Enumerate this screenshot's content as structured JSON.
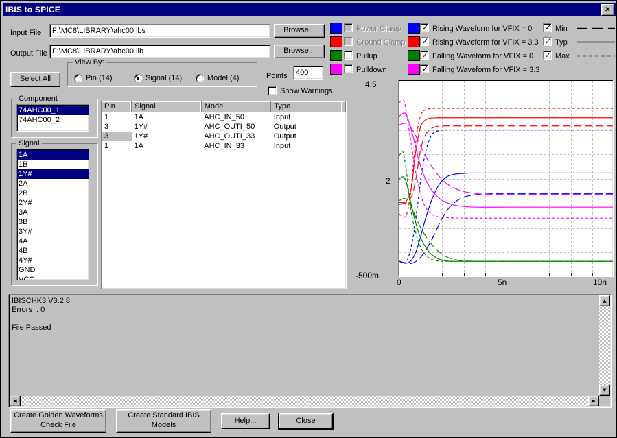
{
  "window": {
    "title": "IBIS to SPICE",
    "close_label": "✕"
  },
  "form": {
    "input_file_label": "Input File",
    "input_file_value": "F:\\MC8\\LIBRARY\\ahc00.ibs",
    "output_file_label": "Output File",
    "output_file_value": "F:\\MC8\\LIBRARY\\ahc00.lib",
    "browse_input_label": "Browse...",
    "browse_output_label": "Browse...",
    "select_all_label": "Select All",
    "points_label": "Points",
    "points_value": "400",
    "show_warnings_label": "Show Warnings",
    "show_warnings_checked": false
  },
  "view_by": {
    "title": "View By:",
    "options": [
      {
        "label": "Pin (14)",
        "selected": false
      },
      {
        "label": "Signal (14)",
        "selected": true
      },
      {
        "label": "Model (4)",
        "selected": false
      }
    ]
  },
  "component": {
    "title": "Component",
    "items": [
      {
        "label": "74AHC00_1",
        "selected": true
      },
      {
        "label": "74AHC00_2",
        "selected": false
      }
    ]
  },
  "signal": {
    "title": "Signal",
    "items": [
      {
        "label": "1A",
        "selected": true
      },
      {
        "label": "1B",
        "selected": false
      },
      {
        "label": "1Y#",
        "selected": true
      },
      {
        "label": "2A",
        "selected": false
      },
      {
        "label": "2B",
        "selected": false
      },
      {
        "label": "2Y#",
        "selected": false
      },
      {
        "label": "3A",
        "selected": false
      },
      {
        "label": "3B",
        "selected": false
      },
      {
        "label": "3Y#",
        "selected": false
      },
      {
        "label": "4A",
        "selected": false
      },
      {
        "label": "4B",
        "selected": false
      },
      {
        "label": "4Y#",
        "selected": false
      },
      {
        "label": "GND",
        "selected": false
      },
      {
        "label": "VCC",
        "selected": false
      }
    ]
  },
  "grid": {
    "columns": [
      "Pin",
      "Signal",
      "Model",
      "Type"
    ],
    "rows": [
      {
        "pin": "1",
        "signal": "1A",
        "model": "AHC_IN_50",
        "type": "Input",
        "selected": false
      },
      {
        "pin": "3",
        "signal": "1Y#",
        "model": "AHC_OUTI_50",
        "type": "Output",
        "selected": false
      },
      {
        "pin": "3",
        "signal": "1Y#",
        "model": "AHC_OUTI_33",
        "type": "Output",
        "selected": true
      },
      {
        "pin": "1",
        "signal": "1A",
        "model": "AHC_IN_33",
        "type": "Input",
        "selected": false
      }
    ]
  },
  "legend": {
    "curve_types": [
      {
        "label": "Power Clamp",
        "color": "#0000ff",
        "checked": false,
        "disabled": true
      },
      {
        "label": "Ground Clamp",
        "color": "#ff0000",
        "checked": false,
        "disabled": true
      },
      {
        "label": "Pullup",
        "color": "#008000",
        "checked": false,
        "disabled": false
      },
      {
        "label": "Pulldown",
        "color": "#ff00ff",
        "checked": false,
        "disabled": false
      }
    ],
    "waveforms": [
      {
        "label": "Rising Waveform for VFIX = 0",
        "color": "#0000ff",
        "checked": true
      },
      {
        "label": "Rising Waveform for VFIX = 3.3",
        "color": "#ff0000",
        "checked": true
      },
      {
        "label": "Falling Waveform for VFIX = 0",
        "color": "#008000",
        "checked": true
      },
      {
        "label": "Falling Waveform for VFIX = 3.3",
        "color": "#ff00ff",
        "checked": true
      }
    ],
    "corners": [
      {
        "label": "Min",
        "checked": true,
        "style": "long-dash"
      },
      {
        "label": "Typ",
        "checked": true,
        "style": "solid"
      },
      {
        "label": "Max",
        "checked": true,
        "style": "short-dash"
      }
    ]
  },
  "log": {
    "text": "IBISCHK3 V3.2.8\nErrors  : 0\n\nFile Passed"
  },
  "buttons": {
    "golden": "Create Golden Waveforms\nCheck File",
    "standard": "Create Standard IBIS\nModels",
    "help": "Help...",
    "close": "Close"
  },
  "chart_data": {
    "type": "line",
    "title": "",
    "xlabel": "",
    "ylabel": "",
    "xlim": [
      0,
      10
    ],
    "ylim": [
      -0.5,
      4.5
    ],
    "xunit": "n",
    "xticks": [
      0,
      5,
      10
    ],
    "xticklabels": [
      "0",
      "5n",
      "10n"
    ],
    "yticks": [
      -0.5,
      2,
      4.5
    ],
    "yticklabels": [
      "-500m",
      "2",
      "4.5"
    ],
    "grid": true,
    "grid_x_count": 10,
    "grid_y_count": 8,
    "legend_position": "top-external",
    "series": [
      {
        "name": "Rising Waveform for VFIX = 3.3 (Max)",
        "color": "#ff0000",
        "style": "short-dash",
        "x": [
          0.0,
          0.3,
          0.5,
          0.65,
          0.8,
          0.95,
          1.1,
          1.3,
          1.6,
          2.0,
          3.0,
          5.0,
          7.5,
          10.0
        ],
        "y": [
          1.1,
          1.05,
          1.55,
          2.35,
          3.1,
          3.55,
          3.72,
          3.78,
          3.8,
          3.8,
          3.8,
          3.8,
          3.8,
          3.8
        ]
      },
      {
        "name": "Rising Waveform for VFIX = 3.3 (Typ)",
        "color": "#ff0000",
        "style": "solid",
        "x": [
          0.0,
          0.3,
          0.55,
          0.7,
          0.85,
          1.0,
          1.2,
          1.45,
          1.8,
          2.2,
          3.0,
          5.0,
          7.5,
          10.0
        ],
        "y": [
          1.4,
          1.42,
          1.75,
          2.45,
          3.0,
          3.35,
          3.5,
          3.55,
          3.56,
          3.56,
          3.56,
          3.56,
          3.56,
          3.56
        ]
      },
      {
        "name": "Rising Waveform for VFIX = 3.3 (Min)",
        "color": "#ff0000",
        "style": "long-dash",
        "x": [
          0.0,
          0.35,
          0.6,
          0.8,
          0.95,
          1.15,
          1.4,
          1.7,
          2.05,
          2.4,
          3.0,
          5.0,
          7.5,
          10.0
        ],
        "y": [
          1.35,
          1.4,
          1.6,
          2.1,
          2.65,
          3.05,
          3.25,
          3.33,
          3.35,
          3.35,
          3.35,
          3.35,
          3.35,
          3.35
        ]
      },
      {
        "name": "Rising Waveform for VFIX = 0 (Max)",
        "color": "#0000ff",
        "style": "short-dash",
        "x": [
          0.0,
          0.25,
          0.45,
          0.65,
          0.85,
          1.05,
          1.3,
          1.55,
          1.85,
          2.2,
          3.0,
          5.0,
          7.5,
          10.0
        ],
        "y": [
          -0.1,
          -0.15,
          0.05,
          0.55,
          1.35,
          2.2,
          2.85,
          3.15,
          3.23,
          3.25,
          3.25,
          3.25,
          3.25,
          3.25
        ]
      },
      {
        "name": "Rising Waveform for VFIX = 0 (Typ)",
        "color": "#0000ff",
        "style": "solid",
        "x": [
          0.0,
          0.4,
          0.7,
          0.95,
          1.2,
          1.5,
          1.85,
          2.2,
          2.6,
          3.0,
          3.4,
          5.0,
          7.5,
          10.0
        ],
        "y": [
          -0.1,
          -0.14,
          0.05,
          0.45,
          0.95,
          1.45,
          1.85,
          2.05,
          2.12,
          2.14,
          2.15,
          2.15,
          2.15,
          2.15
        ]
      },
      {
        "name": "Rising Waveform for VFIX = 0 (Min)",
        "color": "#0000ff",
        "style": "long-dash",
        "x": [
          0.0,
          0.5,
          0.9,
          1.25,
          1.6,
          1.95,
          2.3,
          2.7,
          3.1,
          3.6,
          4.2,
          5.0,
          7.5,
          10.0
        ],
        "y": [
          -0.1,
          -0.16,
          -0.05,
          0.2,
          0.55,
          0.95,
          1.25,
          1.45,
          1.55,
          1.6,
          1.62,
          1.62,
          1.62,
          1.62
        ]
      },
      {
        "name": "Falling Waveform for VFIX = 3.3 (Max)",
        "color": "#ff00ff",
        "style": "short-dash",
        "x": [
          0.0,
          0.2,
          0.35,
          0.55,
          0.75,
          0.95,
          1.15,
          1.4,
          1.7,
          2.1,
          3.0,
          5.0,
          7.5,
          10.0
        ],
        "y": [
          3.95,
          4.0,
          3.6,
          2.9,
          2.2,
          1.7,
          1.35,
          1.15,
          1.05,
          1.02,
          1.0,
          1.0,
          1.0,
          1.0
        ]
      },
      {
        "name": "Falling Waveform for VFIX = 3.3 (Typ)",
        "color": "#ff00ff",
        "style": "solid",
        "x": [
          0.0,
          0.25,
          0.45,
          0.7,
          0.95,
          1.25,
          1.6,
          2.0,
          2.45,
          2.95,
          3.6,
          5.0,
          7.5,
          10.0
        ],
        "y": [
          3.6,
          3.68,
          3.45,
          2.95,
          2.4,
          1.95,
          1.65,
          1.45,
          1.35,
          1.3,
          1.28,
          1.28,
          1.28,
          1.28
        ]
      },
      {
        "name": "Falling Waveform for VFIX = 3.3 (Min)",
        "color": "#ff00ff",
        "style": "long-dash",
        "x": [
          0.0,
          0.3,
          0.55,
          0.85,
          1.2,
          1.6,
          2.05,
          2.5,
          3.0,
          3.5,
          4.1,
          5.0,
          7.5,
          10.0
        ],
        "y": [
          3.38,
          3.42,
          3.3,
          3.0,
          2.6,
          2.25,
          1.95,
          1.78,
          1.68,
          1.63,
          1.61,
          1.6,
          1.6,
          1.6
        ]
      },
      {
        "name": "Falling Waveform for VFIX = 0 (Max)",
        "color": "#008000",
        "style": "short-dash",
        "x": [
          0.0,
          0.15,
          0.3,
          0.45,
          0.6,
          0.8,
          1.0,
          1.2,
          1.45,
          1.75,
          2.1,
          3.0,
          5.0,
          10.0
        ],
        "y": [
          2.6,
          2.7,
          2.3,
          1.6,
          1.0,
          0.55,
          0.25,
          0.08,
          -0.04,
          -0.09,
          -0.1,
          -0.1,
          -0.1,
          -0.1
        ]
      },
      {
        "name": "Falling Waveform for VFIX = 0 (Typ)",
        "color": "#008000",
        "style": "solid",
        "x": [
          0.0,
          0.2,
          0.35,
          0.55,
          0.75,
          0.95,
          1.2,
          1.45,
          1.75,
          2.05,
          2.4,
          3.0,
          5.0,
          10.0
        ],
        "y": [
          2.0,
          2.05,
          1.85,
          1.35,
          0.9,
          0.55,
          0.28,
          0.1,
          -0.02,
          -0.08,
          -0.1,
          -0.1,
          -0.1,
          -0.1
        ]
      },
      {
        "name": "Falling Waveform for VFIX = 0 (Min)",
        "color": "#008000",
        "style": "long-dash",
        "x": [
          0.0,
          0.25,
          0.45,
          0.7,
          0.95,
          1.25,
          1.55,
          1.9,
          2.25,
          2.6,
          3.0,
          3.5,
          5.0,
          10.0
        ],
        "y": [
          1.45,
          1.5,
          1.4,
          1.1,
          0.8,
          0.52,
          0.3,
          0.12,
          0.0,
          -0.06,
          -0.09,
          -0.1,
          -0.1,
          -0.1
        ]
      }
    ]
  }
}
